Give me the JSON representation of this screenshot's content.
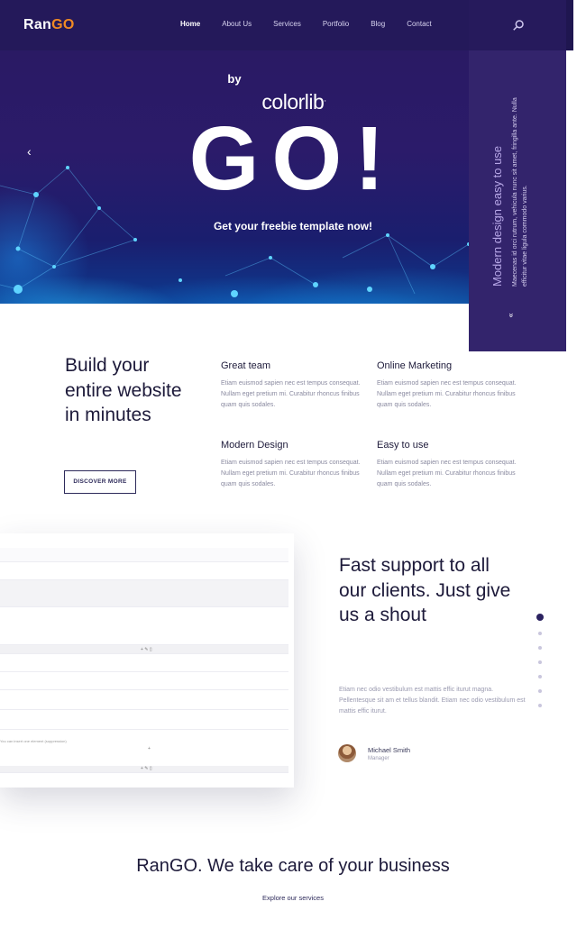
{
  "nav": {
    "logo_main": "Ran",
    "logo_accent": "GO",
    "items": [
      "Home",
      "About Us",
      "Services",
      "Portfolio",
      "Blog",
      "Contact"
    ],
    "active": "Home",
    "search_icon": "search-icon"
  },
  "hero": {
    "by": "by",
    "brand": "colorlib",
    "brand_dot": ".",
    "headline": "GO!",
    "subtitle": "Get your freebie template now!",
    "prev_icon": "‹"
  },
  "side_panel": {
    "title": "Modern design easy to use",
    "text": "Maecenas id orci rutrum, vehicula nunc sit amet, fringilla ante. Nulla efficitur vitae ligula commodo varius.",
    "chevron": "»"
  },
  "features": {
    "title": "Build your entire website in minutes",
    "button": "DISCOVER MORE",
    "items": [
      {
        "title": "Great team",
        "text": "Etiam euismod sapien nec est tempus consequat. Nullam eget pretium mi. Curabitur rhoncus finibus quam quis sodales."
      },
      {
        "title": "Online Marketing",
        "text": "Etiam euismod sapien nec est tempus consequat. Nullam eget pretium mi. Curabitur rhoncus finibus quam quis sodales."
      },
      {
        "title": "Modern Design",
        "text": "Etiam euismod sapien nec est tempus consequat. Nullam eget pretium mi. Curabitur rhoncus finibus quam quis sodales."
      },
      {
        "title": "Easy to use",
        "text": "Etiam euismod sapien nec est tempus consequat. Nullam eget pretium mi. Curabitur rhoncus finibus quam quis sodales."
      }
    ]
  },
  "mock": {
    "note_prefix": "automatic updates and which premium support? Please",
    "note_link": "activate your copy",
    "note_suffix": "of Visual Composer.",
    "bottom_note": "You can insert one element (suppression)",
    "row_icons": "+ ✎ ▯",
    "plus": "+"
  },
  "support": {
    "title": "Fast support to all our clients. Just give us a shout",
    "text": "Etiam nec odio vestibulum est mattis effic iturut magna. Pellentesque sit am et tellus blandit. Etiam nec odio vestibulum est mattis effic iturut.",
    "person_name": "Michael Smith",
    "person_role": "Manager",
    "dots_count": 7,
    "active_dot": 0
  },
  "bottom": {
    "tagline": "RanGO. We take care of your business",
    "link": "Explore our services"
  },
  "colors": {
    "nav_bg": "#24195a",
    "accent": "#f08a24",
    "side_panel": "#33246c",
    "heading": "#1d1a3a"
  }
}
